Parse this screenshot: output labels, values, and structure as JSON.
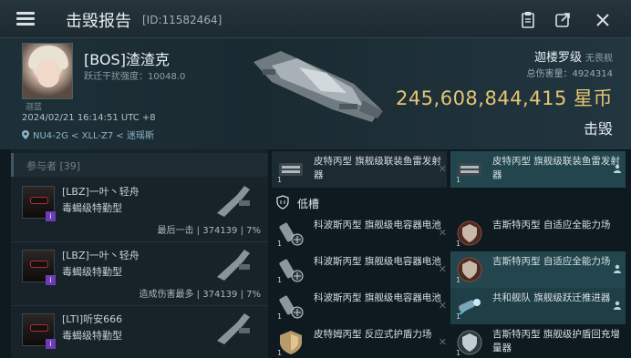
{
  "header": {
    "title": "击毁报告",
    "kill_id": "[ID:11582464]",
    "icons": [
      "menu-icon",
      "clipboard-icon",
      "share-icon",
      "close-icon"
    ]
  },
  "victim": {
    "name": "[BOS]渣渣克",
    "warp_label": "跃迁干扰强度：10048.0",
    "corp_tag": "迦蓝",
    "datetime": "2024/02/21 16:14:51 UTC +8",
    "location": "NU4-2G < XLL-Z7 < 迷瑶斯",
    "ship_class": "迦楼罗级",
    "ship_sub": "无畏舰",
    "damage_taken": "总伤害量：4924314",
    "isk_value": "245,608,844,415",
    "isk_unit": "星币",
    "result": "击毁"
  },
  "participants": {
    "header": "参与者 [39]",
    "list": [
      {
        "name": "[LBZ]一叶丶轻舟",
        "ship": "毒蝎级特勤型",
        "stat": "最后一击 | 374139 | 7%"
      },
      {
        "name": "[LBZ]一叶丶轻舟",
        "ship": "毒蝎级特勤型",
        "stat": "造成伤害最多 | 374139 | 7%"
      },
      {
        "name": "[LTI]听安666",
        "ship": "毒蝎级特勤型",
        "stat": ""
      }
    ]
  },
  "modules": {
    "top_row": [
      {
        "qty": "1",
        "name": "皮特丙型 旗舰级联装鱼雷发射器"
      },
      {
        "qty": "1",
        "name": "皮特丙型 旗舰级联装鱼雷发射器"
      }
    ],
    "low_slot_label": "低槽",
    "left": [
      {
        "qty": "1",
        "name": "科波斯丙型 旗舰级电容器电池"
      },
      {
        "qty": "1",
        "name": "科波斯丙型 旗舰级电容器电池"
      },
      {
        "qty": "1",
        "name": "科波斯丙型 旗舰级电容器电池"
      },
      {
        "qty": "1",
        "name": "皮特姆丙型 反应式护盾力场"
      }
    ],
    "right": [
      {
        "qty": "1",
        "name": "吉斯特丙型 自适应全能力场"
      },
      {
        "qty": "1",
        "name": "吉斯特丙型 自适应全能力场"
      },
      {
        "qty": "1",
        "name": "共和舰队 旗舰级跃迁推进器"
      },
      {
        "qty": "1",
        "name": "吉斯特丙型 旗舰级护盾回充增量器"
      }
    ]
  },
  "colors": {
    "isk": "#e5c672",
    "highlight": "#23464e"
  }
}
